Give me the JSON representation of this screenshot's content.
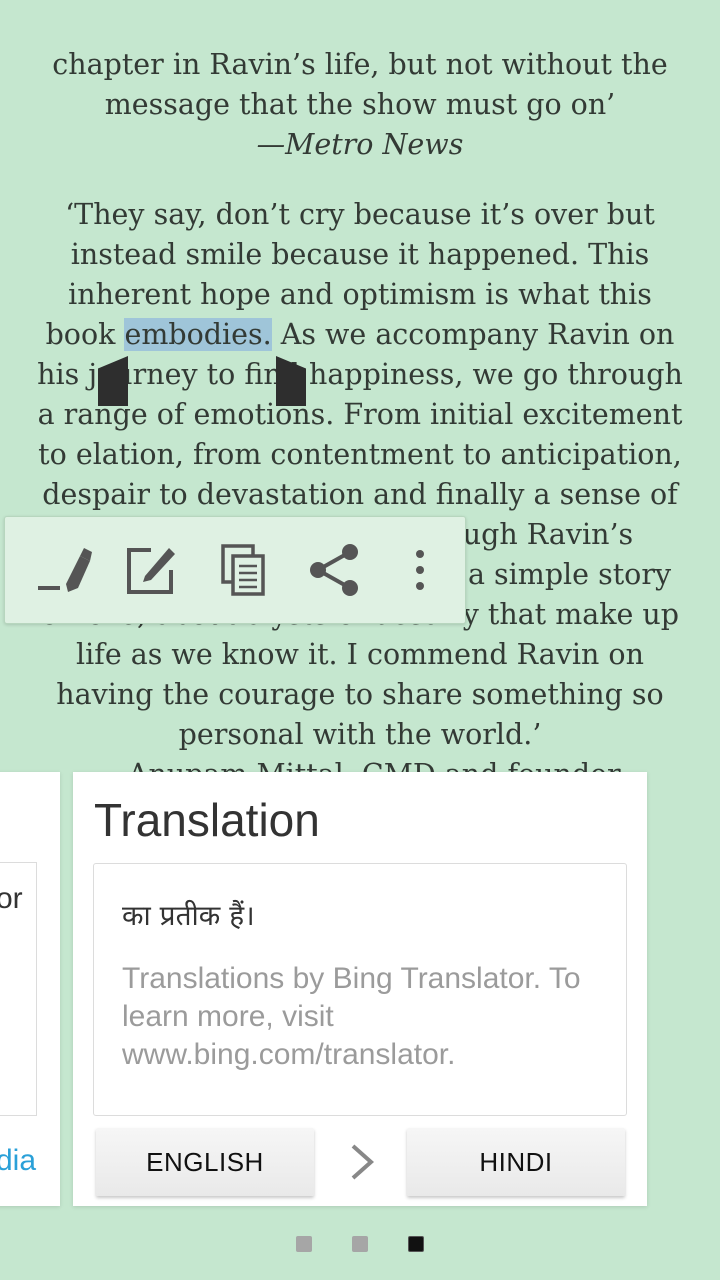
{
  "reader": {
    "lines": [
      "chapter in Ravin’s life, but not without the",
      "message that the show must go on’",
      "—Metro News",
      "‘They say, don’t cry because it’s over but",
      "instead smile because it happened. This",
      "inherent hope and optimism is what this",
      "his journey to find happiness, we go through",
      "a range of emotions. From initial excitement",
      "to elation, from contentment to anticipation,",
      "despair to devastation and finally a sense of",
      "rough Ravin’s",
      "a simple story",
      "of love, about trysts of destiny that make up",
      "life as we know it. I commend Ravin on",
      "having the courage to share something so",
      "personal with the world.’",
      "—Anupam Mittal, CMD and founder"
    ],
    "selected_line": {
      "before": "book ",
      "selected": "embodies.",
      "after": " As we accompany Ravin on"
    }
  },
  "toolbar": {
    "icons": [
      "highlighter-icon",
      "note-edit-icon",
      "copy-icon",
      "share-icon",
      "more-vertical-icon"
    ]
  },
  "prev_card": {
    "text": "or",
    "link": "dia"
  },
  "translation": {
    "title": "Translation",
    "result": "का प्रतीक हैं।",
    "credit": "Translations by Bing Translator. To learn more, visit www.bing.com/translator.",
    "from_language": "ENGLISH",
    "to_language": "HINDI"
  },
  "pager": {
    "count": 3,
    "active_index": 2
  },
  "colors": {
    "background": "#c5e7cf",
    "selection": "#9fc5d9",
    "link": "#2aa0d8"
  }
}
